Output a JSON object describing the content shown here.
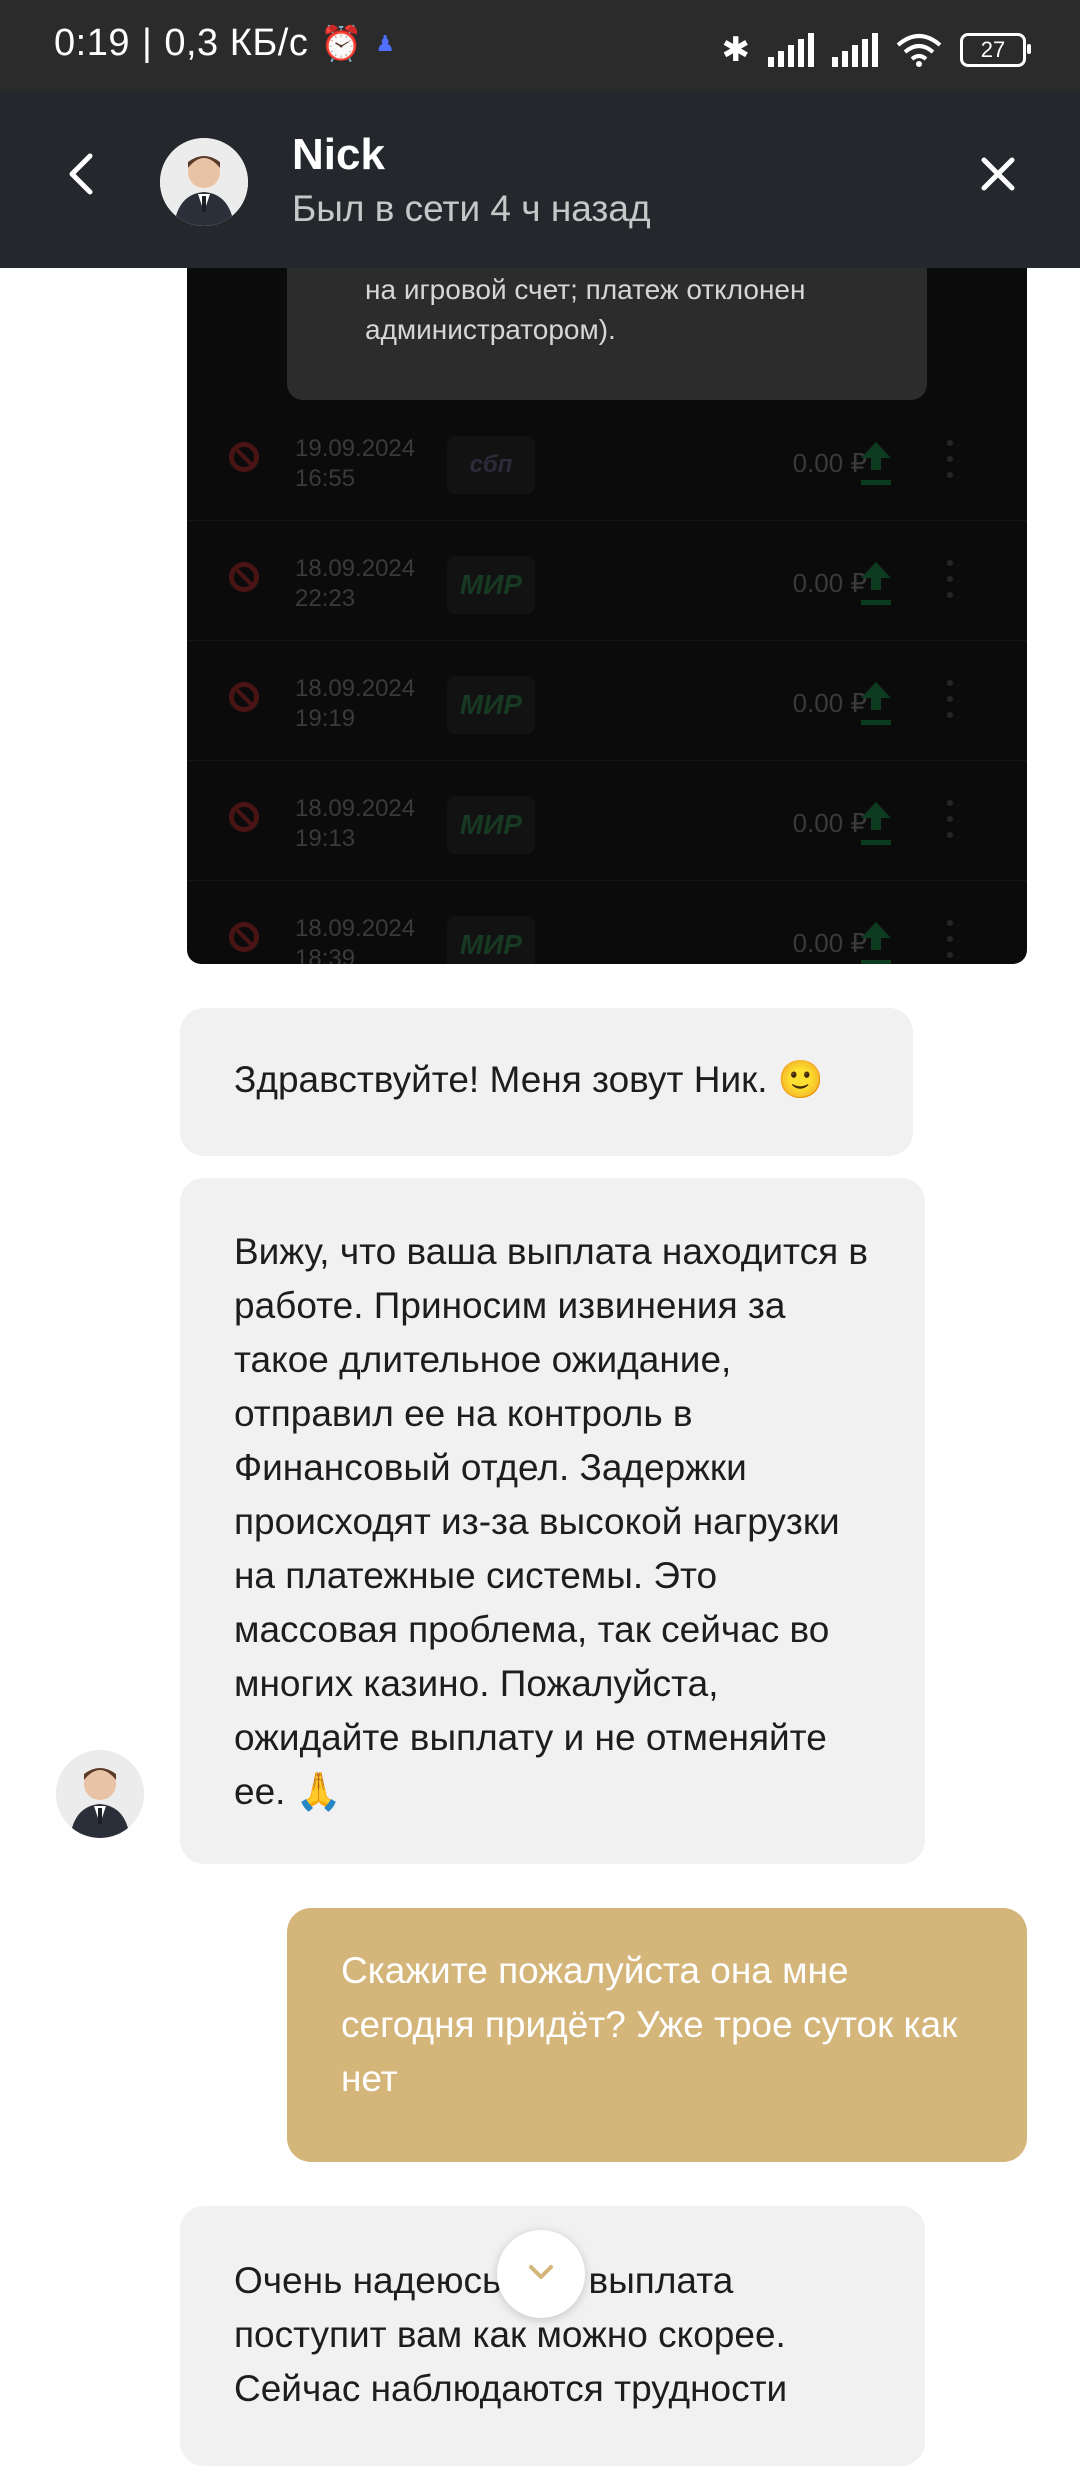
{
  "status_bar": {
    "time": "0:19",
    "speed": "0,3 КБ/с",
    "battery": "27"
  },
  "header": {
    "name": "Nick",
    "status": "Был в сети 4 ч назад"
  },
  "screenshot": {
    "tooltip": "на игровой счет; платеж отклонен администратором).",
    "rows": [
      {
        "date": "19.09.2024",
        "time": "16:55",
        "method": "сбп",
        "amount": "0.00",
        "currency": "₽"
      },
      {
        "date": "18.09.2024",
        "time": "22:23",
        "method": "МИР",
        "amount": "0.00",
        "currency": "₽"
      },
      {
        "date": "18.09.2024",
        "time": "19:19",
        "method": "МИР",
        "amount": "0.00",
        "currency": "₽"
      },
      {
        "date": "18.09.2024",
        "time": "19:13",
        "method": "МИР",
        "amount": "0.00",
        "currency": "₽"
      },
      {
        "date": "18.09.2024",
        "time": "18:39",
        "method": "МИР",
        "amount": "0.00",
        "currency": "₽"
      }
    ]
  },
  "messages": [
    {
      "from": "agent",
      "text": "Здравствуйте! Меня зовут Ник. 🙂"
    },
    {
      "from": "agent",
      "text": "Вижу, что ваша выплата находится в работе. Приносим извинения за такое длительное ожидание, отправил ее на контроль в Финансовый отдел. Задержки происходят из-за высокой нагрузки на платежные системы. Это массовая проблема, так сейчас во многих казино. Пожалуйста, ожидайте выплату и не отменяйте ее. 🙏"
    },
    {
      "from": "user",
      "text": "Скажите пожалуйста она мне сегодня придёт? Уже трое суток как нет"
    },
    {
      "from": "agent",
      "text": "Очень надеюсь, что выплата поступит вам как можно скорее. Сейчас наблюдаются трудности"
    }
  ],
  "icons": {
    "back": "chevron-left-icon",
    "close": "close-icon",
    "scroll_down": "chevron-down-icon"
  }
}
